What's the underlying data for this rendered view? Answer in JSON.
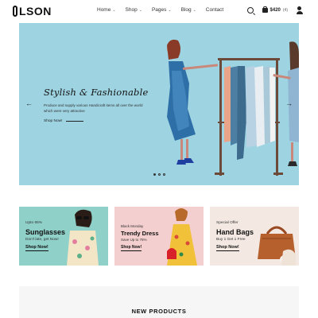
{
  "brand": {
    "logo_text": "LSON"
  },
  "nav": {
    "items": [
      {
        "label": "Home",
        "has_dropdown": true
      },
      {
        "label": "Shop",
        "has_dropdown": true
      },
      {
        "label": "Pages",
        "has_dropdown": true
      },
      {
        "label": "Blog",
        "has_dropdown": true
      },
      {
        "label": "Contact",
        "has_dropdown": false
      }
    ],
    "dropdown_glyph": "⌄"
  },
  "header_icons": {
    "search": "search-icon",
    "cart": "shopping-bag-icon",
    "user": "user-icon"
  },
  "cart": {
    "price": "$420",
    "count": "(4)"
  },
  "hero": {
    "title": "Stylish & Fashionable",
    "description": "Produce and supply various Handicraft items all over the world which were very attractive",
    "link_label": "Shop Now!",
    "prev_arrow": "←",
    "next_arrow": "→",
    "dots_total": 3,
    "dots_active_index": 0,
    "background_color": "#9ed4e2"
  },
  "banners": [
    {
      "small": "Upto 65%",
      "title": "Sunglasses",
      "sub": "Don't late, get Now!",
      "button": "Shop Now!",
      "bg": "#8fd0c9"
    },
    {
      "small": "Black Monday",
      "title": "Trendy Dress",
      "sub": "Save Up to 75%",
      "button": "Shop Now!",
      "bg": "#f4cfcf"
    },
    {
      "small": "Special Offer",
      "title": "Hand Bags",
      "sub": "Buy 1 Get 1 Free",
      "button": "Shop Now!",
      "bg": "#f3e9e2"
    }
  ],
  "new_products": {
    "title": "NEW PRODUCTS"
  }
}
